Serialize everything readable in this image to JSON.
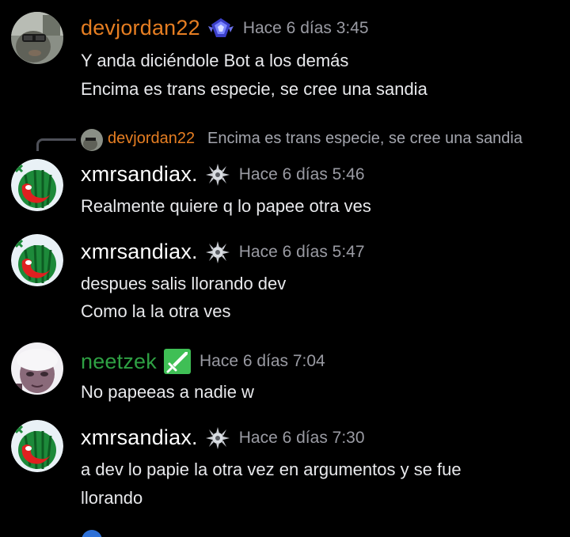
{
  "colors": {
    "background": "#000000",
    "message_text": "#e8e9ec",
    "timestamp": "#9a9ba3",
    "devjordan_name": "#e67e22",
    "xmrsandiax_name": "#ffffff",
    "neetzek_name": "#2ea043",
    "reply_line": "#4e5058"
  },
  "messages": [
    {
      "username": "devjordan22",
      "badge_icon": "diamond-rank-icon",
      "timestamp": "Hace 6 días 3:45",
      "lines": [
        "Y anda diciéndole Bot a los demás",
        "Encima es trans especie, se cree una sandia"
      ]
    },
    {
      "reply": {
        "username": "devjordan22",
        "text": "Encima es trans especie, se cree una sandia"
      },
      "username": "xmrsandiax.",
      "badge_icon": "splash-badge-icon",
      "timestamp": "Hace 6 días 5:46",
      "lines": [
        "Realmente quiere q lo papee otra ves"
      ]
    },
    {
      "username": "xmrsandiax.",
      "badge_icon": "splash-badge-icon",
      "timestamp": "Hace 6 días 5:47",
      "lines": [
        "despues salis llorando dev",
        "Como la la otra ves"
      ]
    },
    {
      "username": "neetzek",
      "badge_icon": "sword-badge-icon",
      "timestamp": "Hace 6 días 7:04",
      "lines": [
        "No papeeas a nadie w"
      ]
    },
    {
      "username": "xmrsandiax.",
      "badge_icon": "splash-badge-icon",
      "timestamp": "Hace 6 días 7:30",
      "lines": [
        "a dev lo papie la otra vez en argumentos y se fue",
        "llorando"
      ]
    }
  ]
}
